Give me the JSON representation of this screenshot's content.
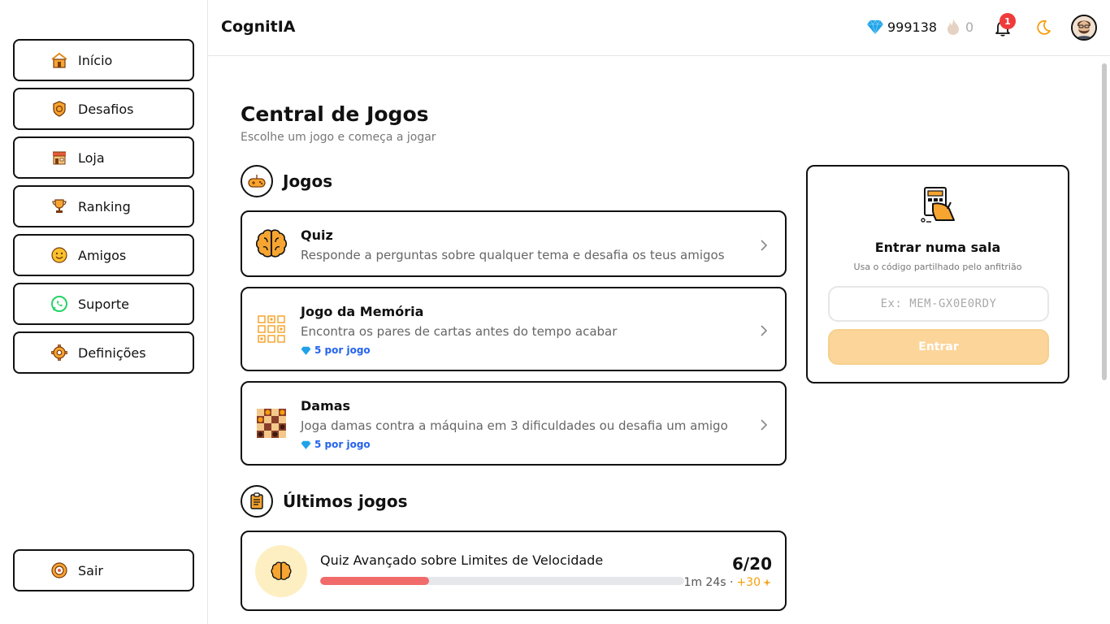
{
  "sidebar": {
    "items": [
      {
        "label": "Início",
        "icon": "home-icon"
      },
      {
        "label": "Desafios",
        "icon": "target-icon"
      },
      {
        "label": "Loja",
        "icon": "store-icon"
      },
      {
        "label": "Ranking",
        "icon": "trophy-icon"
      },
      {
        "label": "Amigos",
        "icon": "smiley-icon"
      },
      {
        "label": "Suporte",
        "icon": "whatsapp-icon"
      },
      {
        "label": "Definições",
        "icon": "gear-icon"
      }
    ],
    "logout_label": "Sair"
  },
  "header": {
    "brand": "CognitIA",
    "gems": "999138",
    "streak": "0",
    "notifications": "1"
  },
  "main": {
    "title": "Central de Jogos",
    "subtitle": "Escolhe um jogo e começa a jogar",
    "games_heading": "Jogos",
    "games": [
      {
        "title": "Quiz",
        "description": "Responde a perguntas sobre qualquer tema e desafia os teus amigos",
        "cost": "",
        "icon": "brain-icon"
      },
      {
        "title": "Jogo da Memória",
        "description": "Encontra os pares de cartas antes do tempo acabar",
        "cost": "5 por jogo",
        "icon": "memory-grid-icon"
      },
      {
        "title": "Damas",
        "description": "Joga damas contra a máquina em 3 dificuldades ou desafia um amigo",
        "cost": "5 por jogo",
        "icon": "checkers-board-icon"
      }
    ],
    "recent_heading": "Últimos jogos",
    "recent": [
      {
        "title": "Quiz Avançado sobre Limites de Velocidade",
        "score": "6/20",
        "progress": 0.3,
        "time": "1m 24s ·",
        "xp": "+30"
      }
    ]
  },
  "room": {
    "title": "Entrar numa sala",
    "subtitle": "Usa o código partilhado pelo anfitrião",
    "placeholder": "Ex: MEM-GX0E0RDY",
    "button_label": "Entrar"
  },
  "colors": {
    "accent": "#f59e0b",
    "gem_blue": "#1fa3e8",
    "progress_red": "#f16b6b",
    "badge_red": "#ef3b3b",
    "cost_blue": "#2563eb"
  }
}
